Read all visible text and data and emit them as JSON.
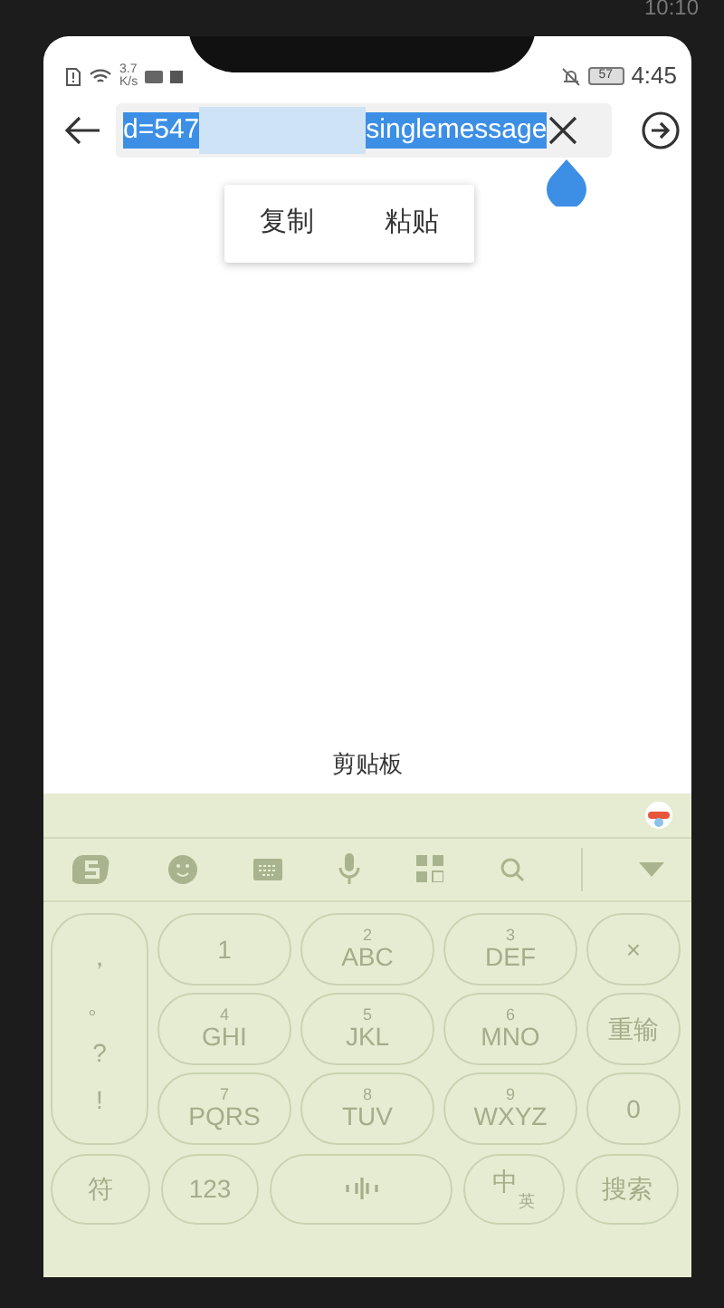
{
  "outer_status": {
    "time": "10:10"
  },
  "status_bar": {
    "speed": "3.7",
    "speed_unit": "K/s",
    "battery": "57",
    "time": "4:45"
  },
  "address_bar": {
    "selected_start": "d=547",
    "selected_end": "singlemessage"
  },
  "context_menu": [
    "复制",
    "粘贴"
  ],
  "clipboard_label": "剪贴板",
  "keyboard": {
    "symbols": [
      "，",
      "。",
      "?",
      "!"
    ],
    "rows": [
      [
        {
          "label": "1"
        },
        {
          "sub": "2",
          "label": "ABC"
        },
        {
          "sub": "3",
          "label": "DEF"
        },
        {
          "label": "×"
        }
      ],
      [
        {
          "sub": "4",
          "label": "GHI"
        },
        {
          "sub": "5",
          "label": "JKL"
        },
        {
          "sub": "6",
          "label": "MNO"
        },
        {
          "label": "重输"
        }
      ],
      [
        {
          "sub": "7",
          "label": "PQRS"
        },
        {
          "sub": "8",
          "label": "TUV"
        },
        {
          "sub": "9",
          "label": "WXYZ"
        },
        {
          "label": "0"
        }
      ]
    ],
    "bottom": [
      {
        "kind": "text",
        "label": "符"
      },
      {
        "kind": "text",
        "label": "123"
      },
      {
        "kind": "voice"
      },
      {
        "kind": "switch",
        "label": "中",
        "sub": "英"
      },
      {
        "kind": "text",
        "label": "搜索"
      }
    ]
  }
}
